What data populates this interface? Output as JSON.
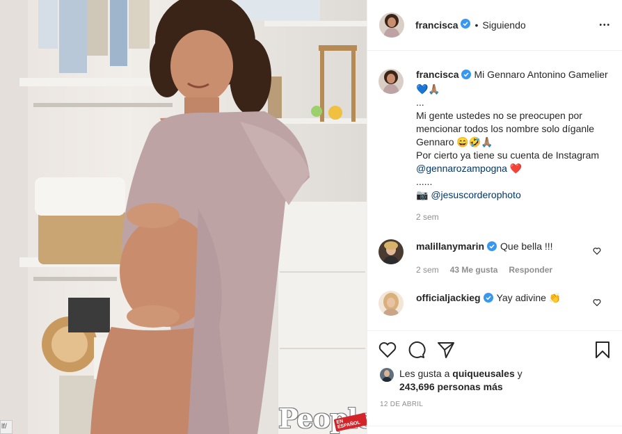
{
  "post": {
    "author": "francisca",
    "follow_state": "Siguiendo",
    "dot": "•",
    "more": "•••"
  },
  "caption": {
    "author": "francisca",
    "line1": "Mi Gennaro Antonino Gamelier 💙🙏🏽",
    "line2": "...",
    "line3": "Mi gente ustedes no se preocupen por mencionar todos los nombre solo díganle Gennaro 😄🤣🙏🏽",
    "line4": "Por cierto ya tiene su cuenta de Instagram",
    "mention": "@gennarozampogna",
    "mention_suffix": " ❤️",
    "line5": "......",
    "credit_prefix": "📷 ",
    "credit": "@jesuscorderophoto",
    "time": "2 sem"
  },
  "comments": [
    {
      "user": "malillanymarin",
      "text": "Que bella !!!",
      "time": "2 sem",
      "likes": "43 Me gusta",
      "reply": "Responder"
    },
    {
      "user": "officialjackieg",
      "text": "Yay adivine 👏"
    }
  ],
  "likes": {
    "prefix": "Les gusta a ",
    "user": "quiqueusales",
    "middle": " y",
    "count": "243,696 personas más"
  },
  "date": "12 DE ABRIL",
  "photo": {
    "logo": "People",
    "badge": "EN ESPAÑOL",
    "corner": "lf/"
  },
  "colors": {
    "verified": "#3897f0",
    "link": "#00376b",
    "muted": "#8e8e8e",
    "text": "#262626"
  }
}
